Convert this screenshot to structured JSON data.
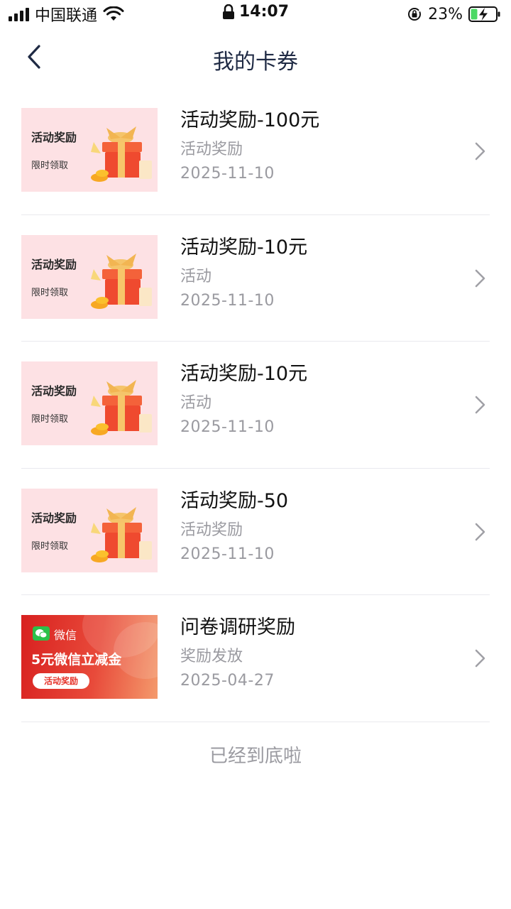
{
  "status_bar": {
    "carrier": "中国联通",
    "time": "14:07",
    "battery": "23%"
  },
  "nav": {
    "title": "我的卡券"
  },
  "coupons": [
    {
      "title": "活动奖励-100元",
      "subtitle": "活动奖励",
      "date": "2025-11-10",
      "thumb_line1": "活动奖励",
      "thumb_line2": "限时领取"
    },
    {
      "title": "活动奖励-10元",
      "subtitle": "活动",
      "date": "2025-11-10",
      "thumb_line1": "活动奖励",
      "thumb_line2": "限时领取"
    },
    {
      "title": "活动奖励-10元",
      "subtitle": "活动",
      "date": "2025-11-10",
      "thumb_line1": "活动奖励",
      "thumb_line2": "限时领取"
    },
    {
      "title": "活动奖励-50",
      "subtitle": "活动奖励",
      "date": "2025-11-10",
      "thumb_line1": "活动奖励",
      "thumb_line2": "限时领取"
    },
    {
      "title": "问卷调研奖励",
      "subtitle": "奖励发放",
      "date": "2025-04-27",
      "thumb_label": "微信",
      "thumb_amount": "5元微信立减金",
      "thumb_button": "活动奖励"
    }
  ],
  "footer": {
    "end_text": "已经到底啦"
  },
  "colors": {
    "accent_pink_bg": "#fde1e4",
    "wechat_red": "#e5332a",
    "wechat_green": "#2cc04a",
    "nav_title": "#1f2a44",
    "muted_text": "#9a9aa0"
  }
}
